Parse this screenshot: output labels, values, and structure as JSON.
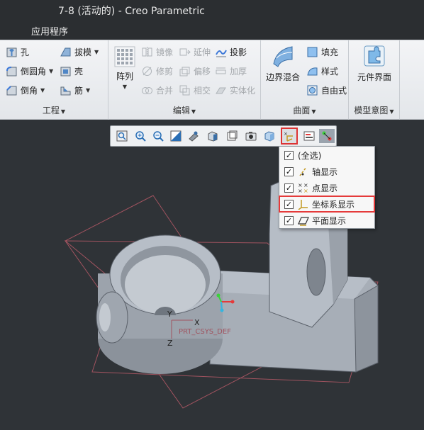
{
  "window": {
    "title": "7-8 (活动的) - Creo Parametric"
  },
  "menu": {
    "app_programs": "应用程序"
  },
  "ribbon": {
    "engineering": {
      "label": "工程",
      "hole": "孔",
      "draft": "拔模",
      "round": "倒圆角",
      "shell": "壳",
      "chamfer": "倒角",
      "rib": "筋"
    },
    "editing": {
      "label": "编辑",
      "pattern": "阵列",
      "mirror": "镜像",
      "extend": "延伸",
      "project": "投影",
      "trim": "修剪",
      "offset": "偏移",
      "thicken": "加厚",
      "merge": "合并",
      "intersect": "相交",
      "solidify": "实体化"
    },
    "surfaces": {
      "label": "曲面",
      "boundary_blend": "边界混合",
      "fill": "填充",
      "style": "样式",
      "freestyle": "自由式"
    },
    "model_intent": {
      "label": "模型意图",
      "component_interface": "元件界面"
    }
  },
  "datum_display_menu": {
    "items": [
      {
        "label": "(全选)",
        "checked": "✓"
      },
      {
        "label": "轴显示",
        "checked": "✓"
      },
      {
        "label": "点显示",
        "checked": "✓"
      },
      {
        "label": "坐标系显示",
        "checked": "✓"
      },
      {
        "label": "平面显示",
        "checked": "✓"
      }
    ]
  },
  "model": {
    "csys_label": "PRT_CSYS_DEF",
    "axis_y": "Y",
    "axis_x": "X",
    "axis_z": "Z"
  },
  "colors": {
    "highlight": "#e53a3a",
    "viewport_bg": "#2f3337",
    "model_gray": "#a9b1bb",
    "datum_plane": "#a0535f"
  }
}
